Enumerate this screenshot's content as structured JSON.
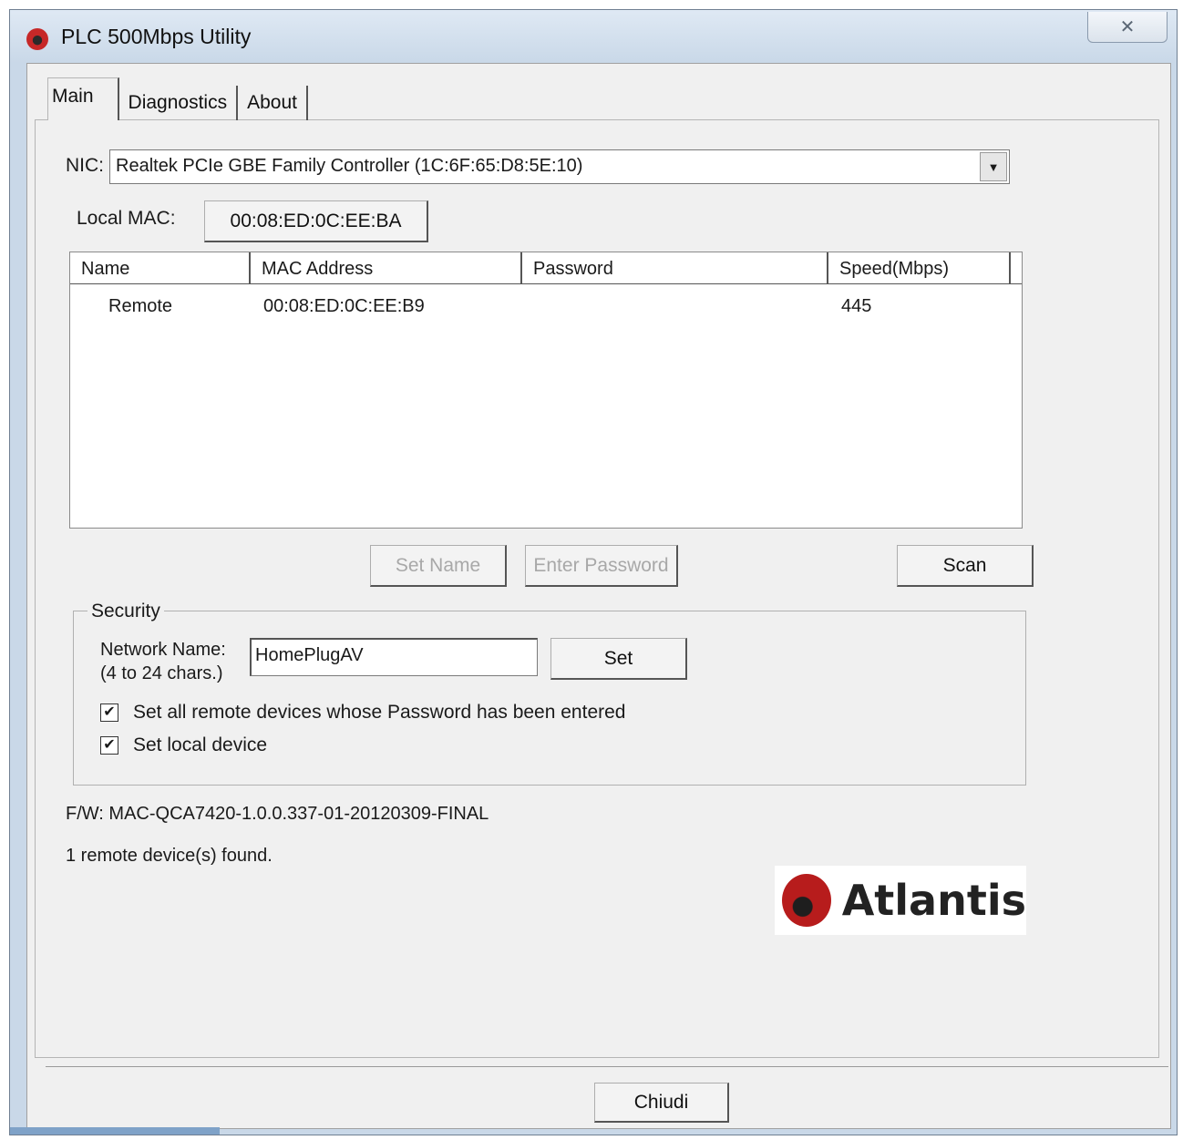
{
  "window": {
    "title": "PLC 500Mbps Utility",
    "close_glyph": "✕"
  },
  "tabs": [
    {
      "label": "Main",
      "active": true
    },
    {
      "label": "Diagnostics",
      "active": false
    },
    {
      "label": "About",
      "active": false
    }
  ],
  "nic": {
    "label": "NIC:",
    "selected": "Realtek PCIe GBE Family Controller (1C:6F:65:D8:5E:10)",
    "arrow_glyph": "▼"
  },
  "local_mac": {
    "label": "Local MAC:",
    "value": "00:08:ED:0C:EE:BA"
  },
  "device_list": {
    "columns": [
      "Name",
      "MAC Address",
      "Password",
      "Speed(Mbps)"
    ],
    "rows": [
      {
        "name": "Remote",
        "mac": "00:08:ED:0C:EE:B9",
        "password": "",
        "speed": "445"
      }
    ]
  },
  "actions": {
    "set_name": "Set Name",
    "enter_password": "Enter Password",
    "scan": "Scan"
  },
  "security": {
    "title": "Security",
    "network_name_label": "Network Name:",
    "network_name_hint": "(4 to 24 chars.)",
    "network_name_value": "HomePlugAV",
    "set_button": "Set",
    "check_remote_label": "Set all remote devices whose Password has been entered",
    "check_remote_checked": true,
    "check_local_label": "Set local device",
    "check_local_checked": true,
    "check_glyph": "✔"
  },
  "firmware": "F/W: MAC-QCA7420-1.0.0.337-01-20120309-FINAL",
  "status": "1 remote device(s) found.",
  "logo_text": "Atlantis",
  "close_button": "Chiudi",
  "colors": {
    "frame": "#c9d8e8",
    "client": "#f0f0f0",
    "brand_red": "#b71c1c"
  }
}
